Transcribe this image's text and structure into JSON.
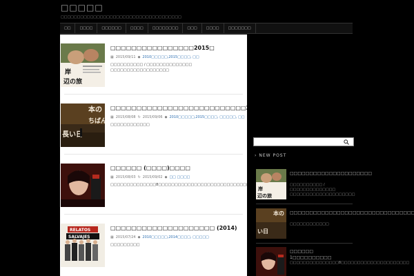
{
  "site": {
    "title": "□□□□□",
    "description": "□□□□□□□□□□□□□□□□□□□□□□□□□□□□□□□□□□□□□"
  },
  "nav": {
    "items": [
      "□□",
      "□□□□",
      "□□□□□□",
      "□□□□",
      "□□□□□□□□",
      "□□□",
      "□□□□",
      "□□□□□□□"
    ]
  },
  "posts": [
    {
      "title": "□□□□□□□□□□□□□□□□2015□",
      "date": "2015/09/11",
      "updated": "",
      "categories": "2010□□□□□,2015□□□□, □□",
      "excerpt": "□□□□□□□□□□ / □□□□□□□□□□□□□□ □□□□□□□□□□□□□□□□□□",
      "thumb_text": "岸 辺の旅"
    },
    {
      "title": "□□□□□□□□□□□□□□□□□□□□□□□□□□2015□",
      "date": "2015/08/08",
      "updated": "2015/09/06",
      "categories": "2010□□□□□,2015□□□□, □□□□□, □□",
      "excerpt": "□□□□□□□□□□□□",
      "thumb_text": "本の ちばん 長い日"
    },
    {
      "title": "□□□□□□ (□□□□)□□□□",
      "date": "2015/08/03",
      "updated": "2015/09/02",
      "categories": "□□ □□□□",
      "excerpt": "□□□□□□□□□□□□□□8□□□□□□□□□□□□□□□□□□□□□□□□□□□□□□□□□□□□□□1□",
      "thumb_text": ""
    },
    {
      "title": "□□□□□□□□□□□□□□□□□□□□ (2014)",
      "date": "2015/07/24",
      "updated": "",
      "categories": "2010□□□□□,2014□□□□, □□□□□",
      "excerpt": "□□□□□□□□□",
      "thumb_text": "RELATOS SALVAJES"
    }
  ],
  "sidebar": {
    "widget_title": "NEW POST",
    "posts": [
      {
        "title": "□□□□□□□□□□□□□□□□□□□□□",
        "excerpt": "□□□□□□□□□□ / □□□□□□□□□□□□□□ □□□□□□□□□□□□□□□□□□□□"
      },
      {
        "title": "□□□□□□□□□□□□□□□□□□□□□□□□□□□□□□□□□",
        "excerpt": "□□□□□□□□□□□□"
      },
      {
        "title": "□□□□□□ 1□□□□□□□□□□",
        "excerpt": "□□□□□□□□□□□□□□□8□□□□□□□□□□□□□□□□□□□□□"
      }
    ]
  },
  "colors": {
    "background": "#000000",
    "content_bg": "#ffffff",
    "link": "#2a6db0"
  }
}
